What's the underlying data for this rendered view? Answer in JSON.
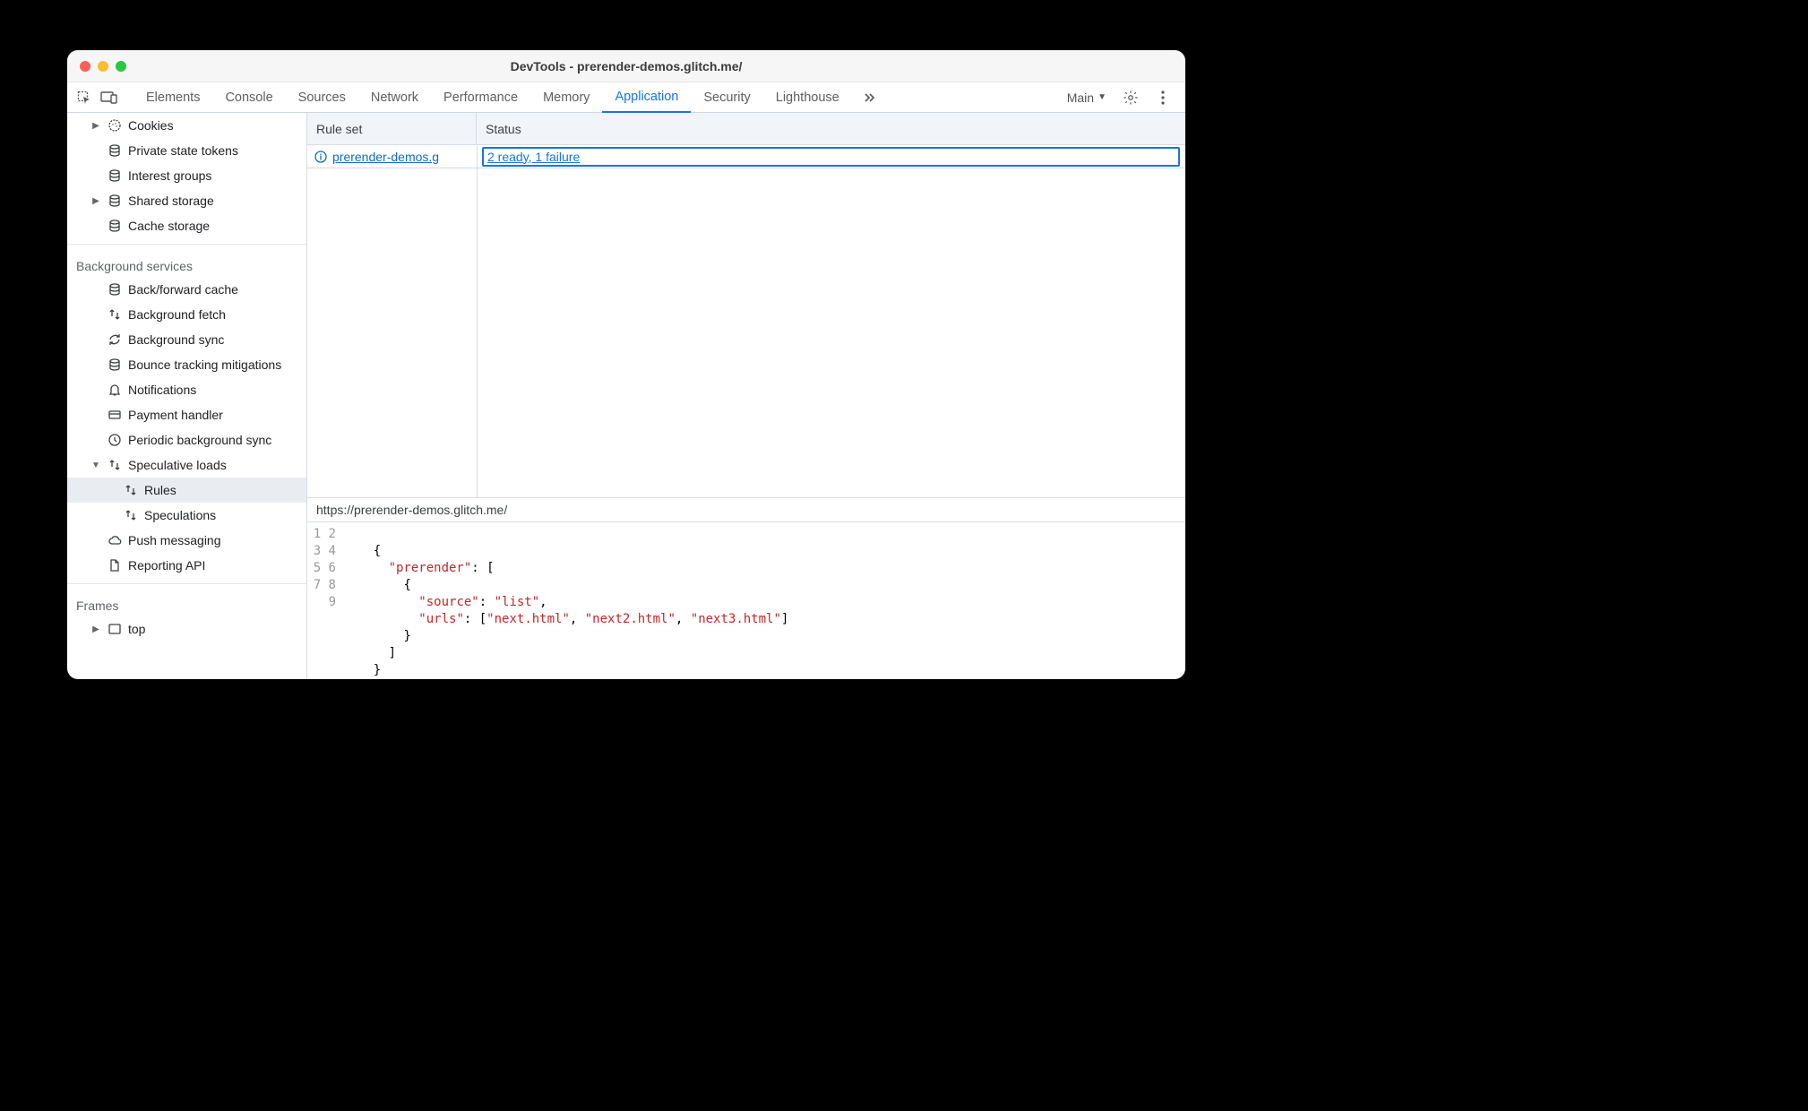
{
  "window": {
    "title": "DevTools - prerender-demos.glitch.me/"
  },
  "toolbar": {
    "tabs": [
      "Elements",
      "Console",
      "Sources",
      "Network",
      "Performance",
      "Memory",
      "Application",
      "Security",
      "Lighthouse"
    ],
    "active": "Application",
    "target_label": "Main"
  },
  "sidebar": {
    "storage": [
      {
        "label": "Cookies",
        "icon": "cookie",
        "expandable": true
      },
      {
        "label": "Private state tokens",
        "icon": "db"
      },
      {
        "label": "Interest groups",
        "icon": "db"
      },
      {
        "label": "Shared storage",
        "icon": "db",
        "expandable": true
      },
      {
        "label": "Cache storage",
        "icon": "db"
      }
    ],
    "bg_header": "Background services",
    "bg": [
      {
        "label": "Back/forward cache",
        "icon": "db"
      },
      {
        "label": "Background fetch",
        "icon": "updown"
      },
      {
        "label": "Background sync",
        "icon": "sync"
      },
      {
        "label": "Bounce tracking mitigations",
        "icon": "db"
      },
      {
        "label": "Notifications",
        "icon": "bell"
      },
      {
        "label": "Payment handler",
        "icon": "card"
      },
      {
        "label": "Periodic background sync",
        "icon": "clock"
      },
      {
        "label": "Speculative loads",
        "icon": "updown",
        "expandable": true,
        "expanded": true,
        "children": [
          {
            "label": "Rules",
            "icon": "updown",
            "selected": true
          },
          {
            "label": "Speculations",
            "icon": "updown"
          }
        ]
      },
      {
        "label": "Push messaging",
        "icon": "cloud"
      },
      {
        "label": "Reporting API",
        "icon": "doc"
      }
    ],
    "frames_header": "Frames",
    "frames": [
      {
        "label": "top",
        "icon": "frame",
        "expandable": true
      }
    ]
  },
  "table": {
    "headers": {
      "ruleset": "Rule set",
      "status": "Status"
    },
    "rows": [
      {
        "ruleset_label": "prerender-demos.g",
        "status": "2 ready, 1 failure"
      }
    ]
  },
  "source": {
    "url": "https://prerender-demos.glitch.me/",
    "line_count": 9,
    "json": {
      "prerender_key": "prerender",
      "source_key": "source",
      "source_val": "list",
      "urls_key": "urls",
      "urls": [
        "next.html",
        "next2.html",
        "next3.html"
      ]
    }
  }
}
